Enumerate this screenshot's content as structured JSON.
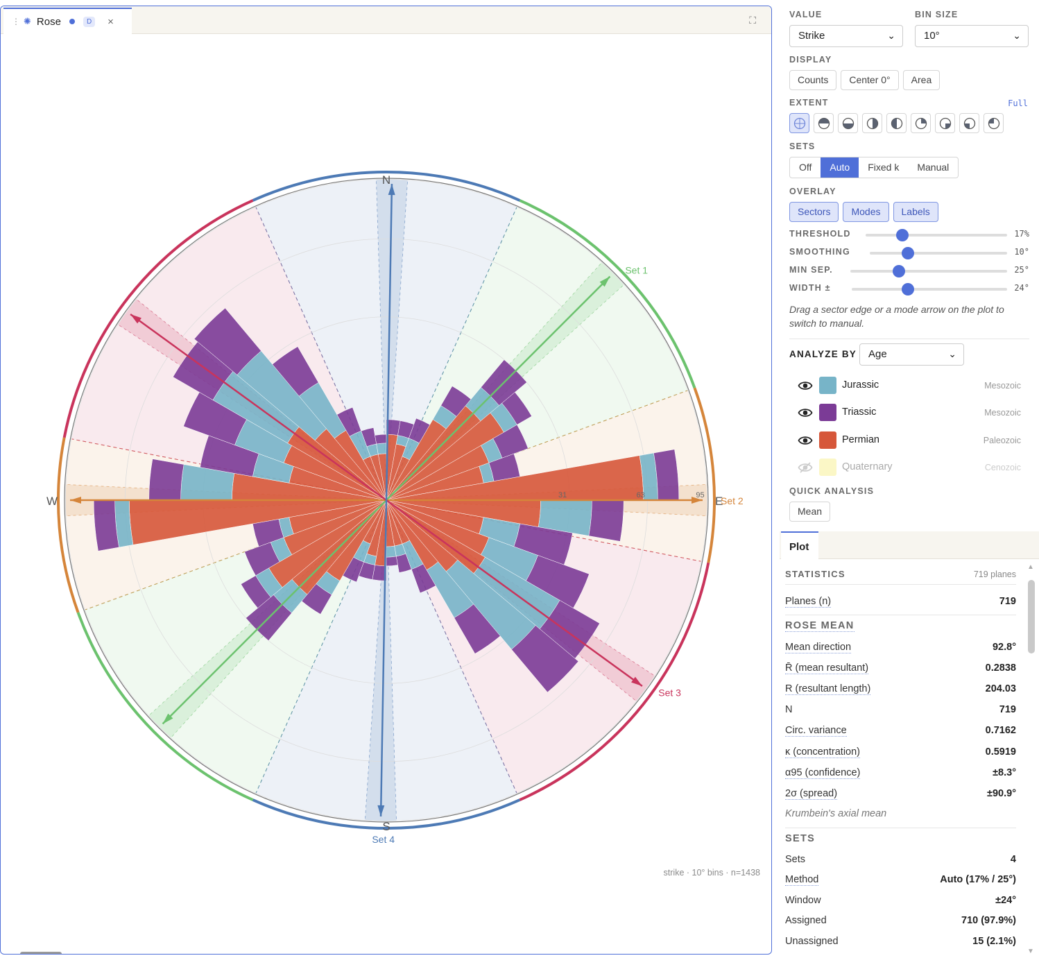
{
  "tab": {
    "title": "Rose",
    "badge": "D",
    "close": "×",
    "grip": "⋮",
    "expand": "⛶"
  },
  "footnote": "strike · 10° bins · n=1438",
  "controls": {
    "value_label": "VALUE",
    "value": "Strike",
    "bin_label": "BIN SIZE",
    "bin": "10°",
    "display_label": "DISPLAY",
    "display_buttons": [
      "Counts",
      "Center 0°",
      "Area"
    ],
    "extent_label": "EXTENT",
    "extent_value": "Full",
    "sets_label": "SETS",
    "sets_options": [
      "Off",
      "Auto",
      "Fixed k",
      "Manual"
    ],
    "sets_active": "Auto",
    "overlay_label": "OVERLAY",
    "overlay_buttons": [
      "Sectors",
      "Modes",
      "Labels"
    ],
    "sliders": [
      {
        "label": "THRESHOLD",
        "value": "17%",
        "frac": 0.26
      },
      {
        "label": "SMOOTHING",
        "value": "10°",
        "frac": 0.28
      },
      {
        "label": "MIN SEP.",
        "value": "25°",
        "frac": 0.31
      },
      {
        "label": "WIDTH ±",
        "value": "24°",
        "frac": 0.36
      }
    ],
    "hint": "Drag a sector edge or a mode arrow on the plot to switch to manual.",
    "analyze_label": "ANALYZE BY",
    "analyze_value": "Age",
    "quick_label": "QUICK ANALYSIS",
    "quick_button": "Mean"
  },
  "legend": [
    {
      "name": "Jurassic",
      "era": "Mesozoic",
      "color": "#77b4c8",
      "visible": true
    },
    {
      "name": "Triassic",
      "era": "Mesozoic",
      "color": "#7b3b96",
      "visible": true
    },
    {
      "name": "Permian",
      "era": "Paleozoic",
      "color": "#d6573a",
      "visible": true
    },
    {
      "name": "Quaternary",
      "era": "Cenozoic",
      "color": "#fbf7c6",
      "visible": false
    }
  ],
  "plot_tab": "Plot",
  "stats": {
    "statistics_label": "STATISTICS",
    "statistics_sub": "719 planes",
    "planes_label": "Planes (n)",
    "planes_value": "719",
    "rose_mean_label": "ROSE MEAN",
    "rose_mean_rows": [
      {
        "k": "Mean direction",
        "v": "92.8°"
      },
      {
        "k": "R̄ (mean resultant)",
        "v": "0.2838"
      },
      {
        "k": "R (resultant length)",
        "v": "204.03"
      },
      {
        "k": "N",
        "v": "719"
      },
      {
        "k": "Circ. variance",
        "v": "0.7162"
      },
      {
        "k": "κ (concentration)",
        "v": "0.5919"
      },
      {
        "k": "α95 (confidence)",
        "v": "±8.3°"
      },
      {
        "k": "2σ (spread)",
        "v": "±90.9°"
      }
    ],
    "rose_mean_note": "Krumbein's axial mean",
    "sets_label": "SETS",
    "sets_rows": [
      {
        "k": "Sets",
        "v": "4"
      },
      {
        "k": "Method",
        "v": "Auto (17% / 25°)"
      },
      {
        "k": "Window",
        "v": "±24°"
      },
      {
        "k": "Assigned",
        "v": "710 (97.9%)"
      },
      {
        "k": "Unassigned",
        "v": "15 (2.1%)"
      }
    ]
  },
  "chart_data": {
    "type": "rose",
    "value": "strike",
    "bin_deg": 10,
    "n": 1438,
    "compass_labels": [
      "N",
      "E",
      "S",
      "W"
    ],
    "ring_ticks": [
      31,
      63,
      95
    ],
    "rmax": 95,
    "series_colors": {
      "Permian": "#d6573a",
      "Jurassic": "#77b4c8",
      "Triassic": "#7b3b96"
    },
    "bins_center_deg": [
      5,
      15,
      25,
      35,
      45,
      55,
      65,
      75,
      85,
      95,
      105,
      115,
      125,
      135,
      145,
      155,
      165,
      175
    ],
    "stacks": {
      "Permian": [
        4,
        3,
        2,
        8,
        14,
        17,
        11,
        9,
        61,
        22,
        9,
        11,
        12,
        8,
        6,
        2,
        2,
        2
      ],
      "Jurassic": [
        0,
        1,
        2,
        3,
        6,
        4,
        3,
        2,
        7,
        17,
        8,
        13,
        25,
        27,
        11,
        3,
        1,
        1
      ],
      "Triassic": [
        2,
        2,
        3,
        5,
        11,
        5,
        7,
        6,
        11,
        13,
        16,
        19,
        19,
        23,
        12,
        4,
        2,
        1
      ]
    },
    "sets": [
      {
        "label": "Set 1",
        "color": "#6cc26e",
        "center": 45,
        "width": 24,
        "sector": [
          24,
          70
        ]
      },
      {
        "label": "Set 2",
        "color": "#d5853a",
        "center": 90,
        "width": 24,
        "sector": [
          70,
          101
        ]
      },
      {
        "label": "Set 3",
        "color": "#c9345c",
        "center": 126,
        "width": 24,
        "sector": [
          101,
          156
        ]
      },
      {
        "label": "Set 4",
        "color": "#4d7ab5",
        "center": 1,
        "width": 24,
        "sector": [
          156,
          204
        ]
      }
    ]
  }
}
